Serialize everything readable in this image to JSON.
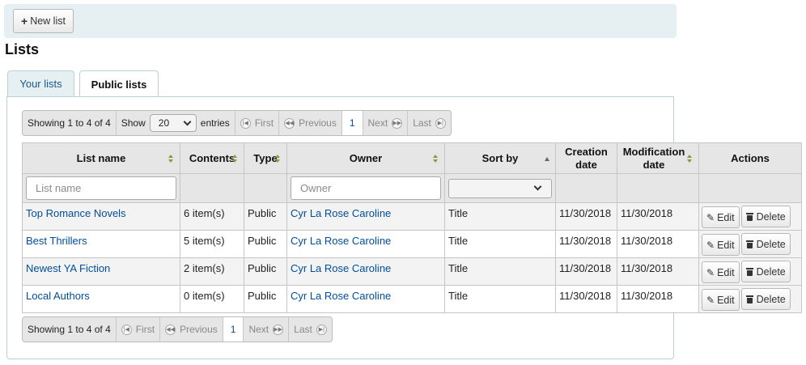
{
  "toolbar": {
    "new_list_label": "New list"
  },
  "page_title": "Lists",
  "tabs": [
    {
      "label": "Your lists",
      "active": false
    },
    {
      "label": "Public lists",
      "active": true
    }
  ],
  "pager_top": {
    "info": "Showing 1 to 4 of 4",
    "show_label": "Show",
    "page_size": "20",
    "entries_label": "entries",
    "first": "First",
    "previous": "Previous",
    "current_page": "1",
    "next": "Next",
    "last": "Last"
  },
  "pager_bottom": {
    "info": "Showing 1 to 4 of 4",
    "first": "First",
    "previous": "Previous",
    "current_page": "1",
    "next": "Next",
    "last": "Last"
  },
  "table": {
    "headers": {
      "list_name": "List name",
      "contents": "Contents",
      "type": "Type",
      "owner": "Owner",
      "sort_by": "Sort by",
      "creation_line1": "Creation",
      "creation_line2": "date",
      "modification_line1": "Modification",
      "modification_line2": "date",
      "actions": "Actions"
    },
    "filters": {
      "list_name_placeholder": "List name",
      "owner_placeholder": "Owner",
      "sort_by_value": ""
    },
    "rows": [
      {
        "name": "Top Romance Novels",
        "contents": "6 item(s)",
        "type": "Public",
        "owner": "Cyr La Rose Caroline",
        "sort_by": "Title",
        "created": "11/30/2018",
        "modified": "11/30/2018",
        "edit": "Edit",
        "delete": "Delete"
      },
      {
        "name": "Best Thrillers",
        "contents": "5 item(s)",
        "type": "Public",
        "owner": "Cyr La Rose Caroline",
        "sort_by": "Title",
        "created": "11/30/2018",
        "modified": "11/30/2018",
        "edit": "Edit",
        "delete": "Delete"
      },
      {
        "name": "Newest YA Fiction",
        "contents": "2 item(s)",
        "type": "Public",
        "owner": "Cyr La Rose Caroline",
        "sort_by": "Title",
        "created": "11/30/2018",
        "modified": "11/30/2018",
        "edit": "Edit",
        "delete": "Delete"
      },
      {
        "name": "Local Authors",
        "contents": "0 item(s)",
        "type": "Public",
        "owner": "Cyr La Rose Caroline",
        "sort_by": "Title",
        "created": "11/30/2018",
        "modified": "11/30/2018",
        "edit": "Edit",
        "delete": "Delete"
      }
    ]
  },
  "colors": {
    "link": "#004d99",
    "toolbar_bg": "#e6f0f2",
    "header_bg": "#e6e6e6",
    "sort_arrow": "#8a9a3a"
  }
}
